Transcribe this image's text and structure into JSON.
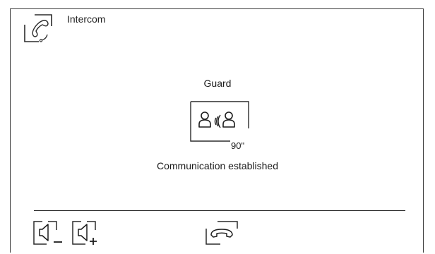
{
  "header": {
    "title": "Intercom",
    "icon": "intercom-handset-icon"
  },
  "call": {
    "name": "Guard",
    "timer": "90\"",
    "status": "Communication established",
    "icon": "two-persons-talking-icon"
  },
  "controls": {
    "volume_down_icon": "speaker-minus-icon",
    "volume_up_icon": "speaker-plus-icon",
    "hangup_icon": "hang-up-icon"
  }
}
